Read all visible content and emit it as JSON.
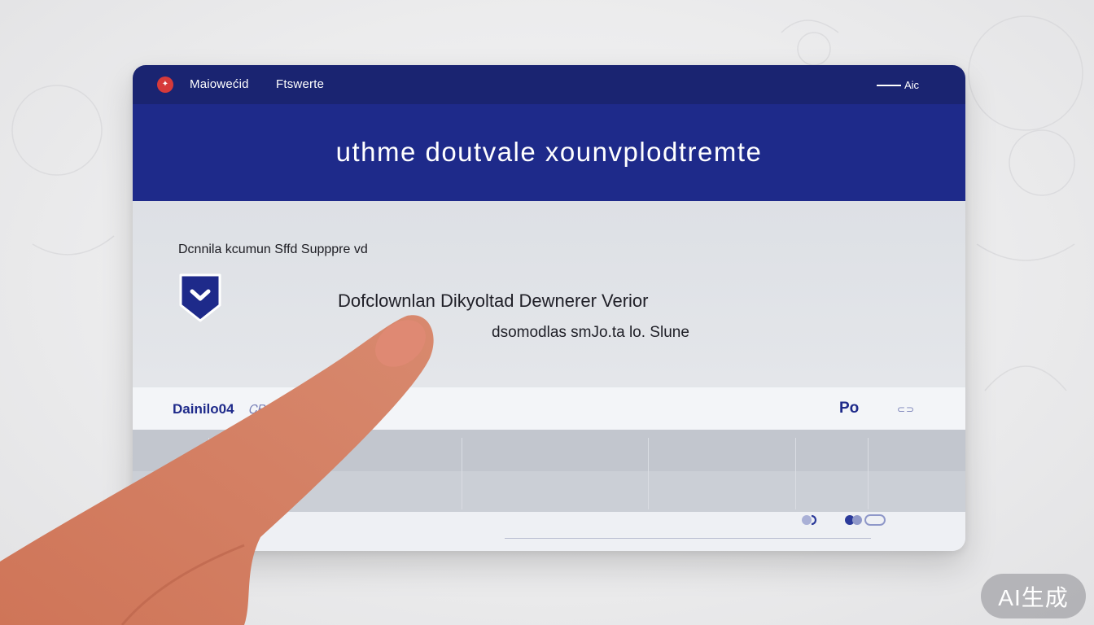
{
  "window": {
    "menu": [
      "Maiowećid",
      "Ftswerte"
    ],
    "title_right": "Aic"
  },
  "hero": {
    "title": "uthme doutvale xounvplodtremte"
  },
  "content": {
    "section_label": "Dcnnila kcumun Sffd Supppre vd",
    "main_heading": "Dofclownlan Dikyoltad Dewnerer Verior",
    "sub_heading": "dsomodlas smJo.ta lo. Slune"
  },
  "info_bar": {
    "primary": "Dainilo04",
    "secondary": "ᏟᏴ0∧6",
    "right": "Po",
    "toggle": "⊂⊃"
  },
  "badge": "AI生成",
  "colors": {
    "titlebar": "#1a2471",
    "hero": "#1e2a8a",
    "accent": "#1e2a8a",
    "logo": "#d63a3a",
    "finger": "#d5826a"
  },
  "icons": {
    "app_logo": "app-logo-icon",
    "shield": "shield-check-icon",
    "footer": [
      "toggle-icon",
      "link-icon"
    ]
  }
}
